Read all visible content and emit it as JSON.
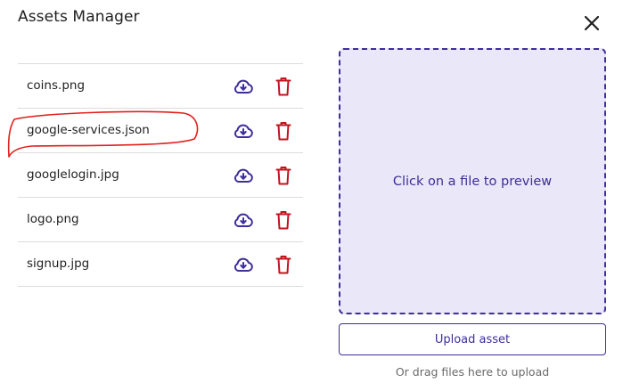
{
  "dialog": {
    "title": "Assets Manager",
    "close_icon": "close-icon"
  },
  "files": [
    {
      "name": "coins.png"
    },
    {
      "name": "google-services.json"
    },
    {
      "name": "googlelogin.jpg"
    },
    {
      "name": "logo.png"
    },
    {
      "name": "signup.jpg"
    }
  ],
  "row_actions": {
    "download_icon": "cloud-download-icon",
    "delete_icon": "trash-icon"
  },
  "preview": {
    "placeholder": "Click on a file to preview"
  },
  "upload": {
    "button_label": "Upload asset",
    "drag_hint": "Or drag files here to upload"
  },
  "colors": {
    "accent": "#3d2e9a",
    "delete": "#c0141d",
    "annotation": "#e0201c",
    "preview_bg": "#eae7f8"
  }
}
